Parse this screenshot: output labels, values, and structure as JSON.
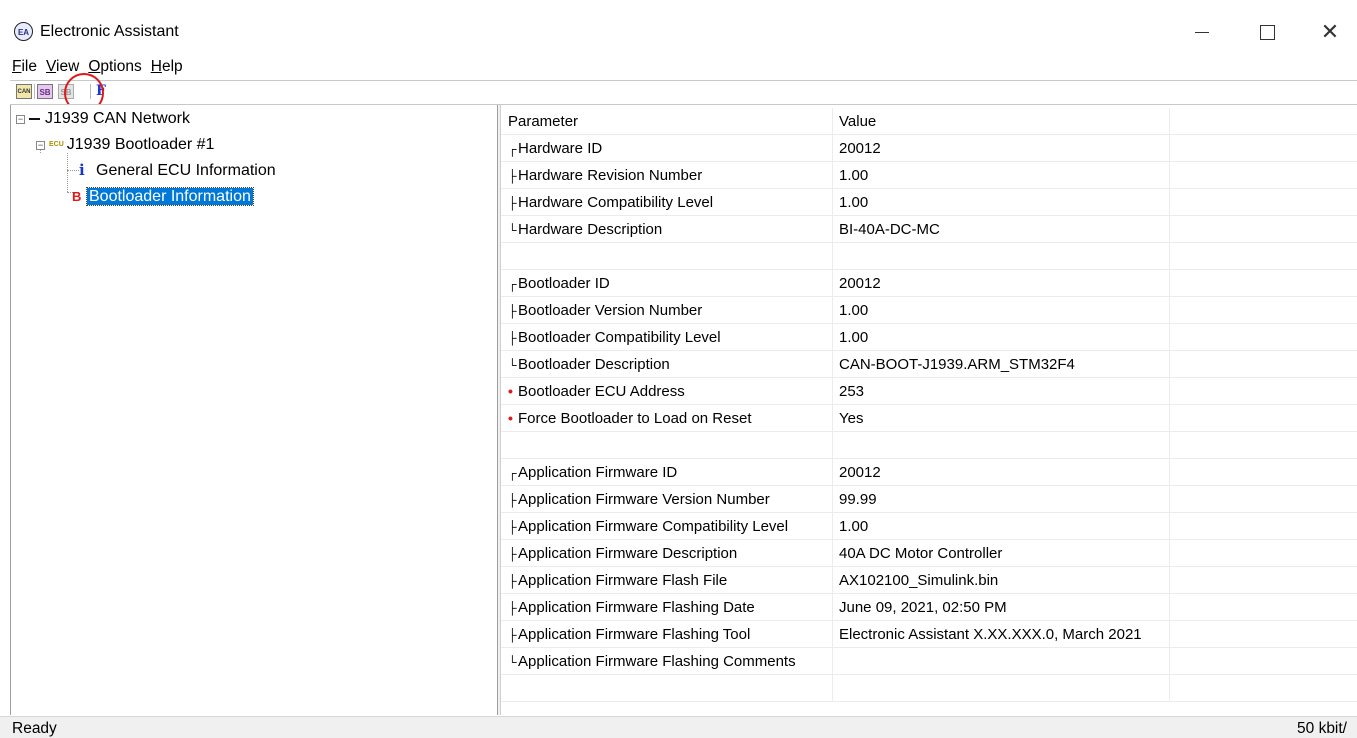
{
  "window": {
    "title": "Electronic Assistant",
    "app_icon": "EA",
    "controls": [
      "minimize-icon",
      "maximize-icon",
      "close-icon"
    ]
  },
  "menu": {
    "items": [
      {
        "label": "File"
      },
      {
        "label": "View"
      },
      {
        "label": "Options"
      },
      {
        "label": "Help"
      }
    ]
  },
  "toolbar": {
    "buttons": [
      {
        "icon": "can-network-icon",
        "text": "CAN"
      },
      {
        "icon": "bootloader-sb-icon",
        "text": "SB"
      },
      {
        "icon": "bootloader-sb-disabled-icon",
        "text": "SB"
      },
      {
        "icon": "flash-f-icon",
        "text": "F"
      }
    ]
  },
  "tree": {
    "root": "J1939 CAN Network",
    "ecu": "J1939 Bootloader #1",
    "ecu_badge": "ECU",
    "children": [
      {
        "label": "General ECU Information",
        "icon": "i"
      },
      {
        "label": "Bootloader Information",
        "icon": "B",
        "selected": true
      }
    ]
  },
  "grid": {
    "columns": [
      "Parameter",
      "Value"
    ],
    "rows": [
      {
        "marker": "┌",
        "param": "Hardware ID",
        "value": "20012"
      },
      {
        "marker": "├",
        "param": "Hardware Revision Number",
        "value": "1.00"
      },
      {
        "marker": "├",
        "param": "Hardware Compatibility Level",
        "value": "1.00"
      },
      {
        "marker": "└",
        "param": "Hardware Description",
        "value": "BI-40A-DC-MC"
      },
      {
        "marker": "",
        "param": "",
        "value": ""
      },
      {
        "marker": "┌",
        "param": "Bootloader ID",
        "value": "20012"
      },
      {
        "marker": "├",
        "param": "Bootloader Version Number",
        "value": "1.00"
      },
      {
        "marker": "├",
        "param": "Bootloader Compatibility Level",
        "value": "1.00"
      },
      {
        "marker": "└",
        "param": "Bootloader Description",
        "value": "CAN-BOOT-J1939.ARM_STM32F4"
      },
      {
        "marker": "•",
        "param": "Bootloader ECU Address",
        "value": "253",
        "red": true
      },
      {
        "marker": "•",
        "param": "Force Bootloader to Load on Reset",
        "value": "Yes",
        "red": true
      },
      {
        "marker": "",
        "param": "",
        "value": ""
      },
      {
        "marker": "┌",
        "param": "Application Firmware ID",
        "value": "20012"
      },
      {
        "marker": "├",
        "param": "Application Firmware Version Number",
        "value": "99.99"
      },
      {
        "marker": "├",
        "param": "Application Firmware Compatibility Level",
        "value": "1.00"
      },
      {
        "marker": "├",
        "param": "Application Firmware Description",
        "value": "40A DC Motor Controller"
      },
      {
        "marker": "├",
        "param": "Application Firmware Flash File",
        "value": "AX102100_Simulink.bin"
      },
      {
        "marker": "├",
        "param": "Application Firmware Flashing Date",
        "value": "June 09, 2021, 02:50 PM"
      },
      {
        "marker": "├",
        "param": "Application Firmware Flashing Tool",
        "value": "Electronic Assistant X.XX.XXX.0, March 2021"
      },
      {
        "marker": "└",
        "param": "Application Firmware Flashing Comments",
        "value": ""
      },
      {
        "marker": "",
        "param": "",
        "value": ""
      }
    ]
  },
  "status": {
    "left": "Ready",
    "right": "50 kbit/"
  }
}
